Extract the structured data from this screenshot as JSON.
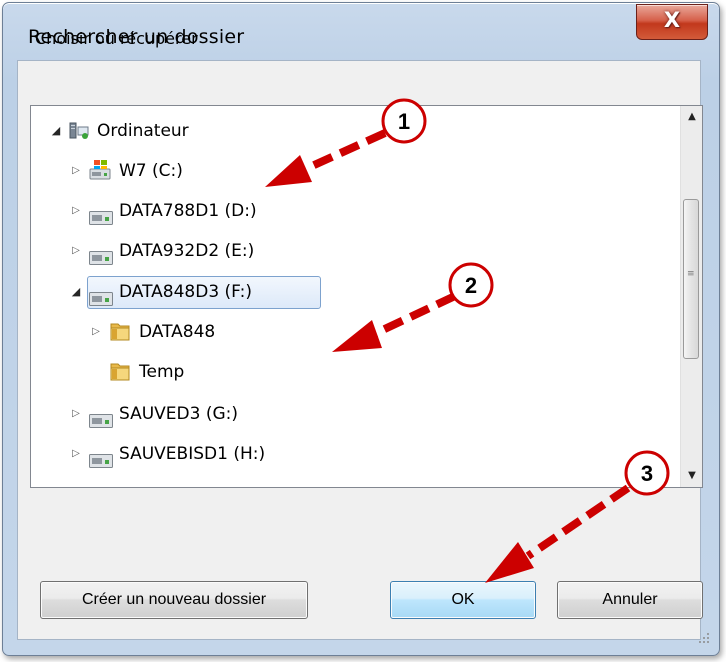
{
  "window": {
    "title": "Rechercher un dossier",
    "close_label": "X"
  },
  "dialog": {
    "instruction": "Choisir où récupérer"
  },
  "tree": {
    "items": [
      {
        "label": "Ordinateur",
        "icon": "computer-icon",
        "expanded": true
      },
      {
        "label": "W7 (C:)",
        "icon": "windows-drive-icon",
        "expanded": false
      },
      {
        "label": "DATA788D1 (D:)",
        "icon": "drive-icon",
        "expanded": false
      },
      {
        "label": "DATA932D2 (E:)",
        "icon": "drive-icon",
        "expanded": false
      },
      {
        "label": "DATA848D3 (F:)",
        "icon": "drive-icon",
        "expanded": true,
        "selected": true
      },
      {
        "label": "DATA848",
        "icon": "folder-icon",
        "expanded": false
      },
      {
        "label": "Temp",
        "icon": "folder-icon"
      },
      {
        "label": "SAUVED3 (G:)",
        "icon": "drive-icon",
        "expanded": false
      },
      {
        "label": "SAUVEBISD1 (H:)",
        "icon": "drive-icon",
        "expanded": false
      }
    ]
  },
  "buttons": {
    "new_folder": "Créer un nouveau dossier",
    "ok": "OK",
    "cancel": "Annuler"
  },
  "callouts": [
    "1",
    "2",
    "3"
  ],
  "colors": {
    "arrow": "#cc0000",
    "callout_fill": "#ffffff",
    "selection_border": "#7da2ce",
    "close_button": "#c2381c"
  }
}
